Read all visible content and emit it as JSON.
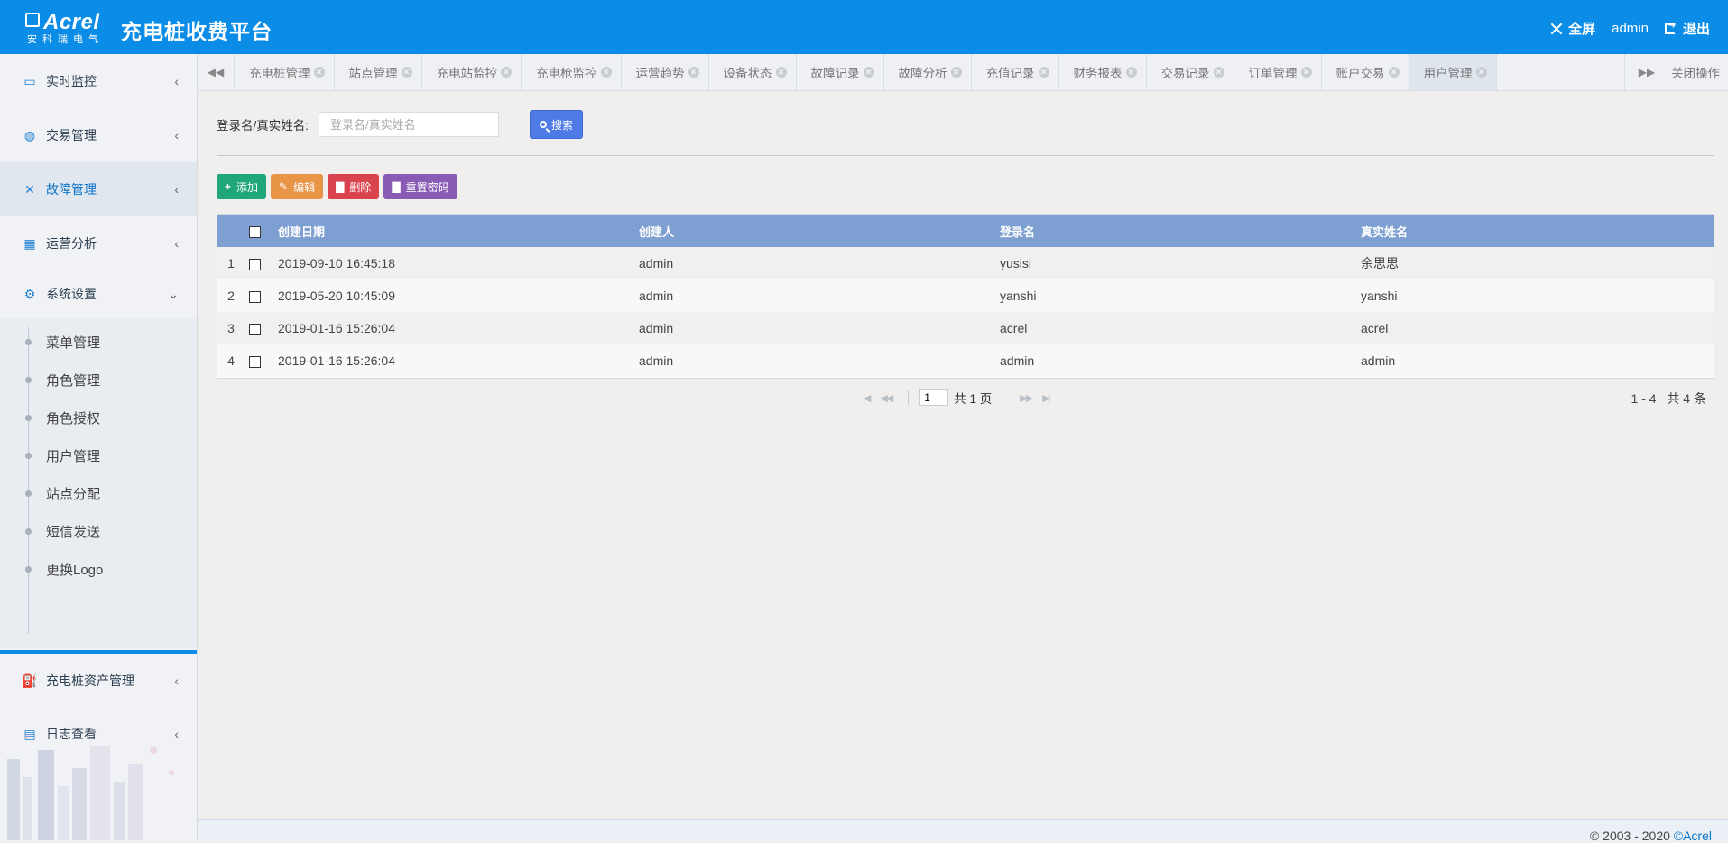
{
  "header": {
    "brand": "Acrel",
    "brand_sub": "安科瑞电气",
    "app_title": "充电桩收费平台",
    "fullscreen_label": "全屏",
    "username": "admin",
    "logout_label": "退出"
  },
  "sidebar": {
    "items": [
      {
        "label": "实时监控",
        "icon": "monitor-icon"
      },
      {
        "label": "交易管理",
        "icon": "trade-icon"
      },
      {
        "label": "故障管理",
        "icon": "tools-icon"
      },
      {
        "label": "运营分析",
        "icon": "calendar-icon"
      },
      {
        "label": "系统设置",
        "icon": "gear-icon"
      },
      {
        "label": "充电桩资产管理",
        "icon": "charger-icon"
      },
      {
        "label": "日志查看",
        "icon": "log-icon"
      }
    ],
    "sub_items": [
      "菜单管理",
      "角色管理",
      "角色授权",
      "用户管理",
      "站点分配",
      "短信发送",
      "更换Logo"
    ]
  },
  "tabs": {
    "items": [
      "充电桩管理",
      "站点管理",
      "充电站监控",
      "充电枪监控",
      "运营趋势",
      "设备状态",
      "故障记录",
      "故障分析",
      "充值记录",
      "财务报表",
      "交易记录",
      "订单管理",
      "账户交易",
      "用户管理"
    ],
    "active_index": 13,
    "close_ops_label": "关闭操作"
  },
  "search": {
    "label": "登录名/真实姓名:",
    "placeholder": "登录名/真实姓名",
    "button_label": "搜索"
  },
  "toolbar": {
    "add_label": "添加",
    "edit_label": "编辑",
    "delete_label": "删除",
    "reset_label": "重置密码"
  },
  "table": {
    "headers": [
      "创建日期",
      "创建人",
      "登录名",
      "真实姓名"
    ],
    "rows": [
      {
        "index": "1",
        "date": "2019-09-10 16:45:18",
        "creator": "admin",
        "login": "yusisi",
        "real_name": "余思思"
      },
      {
        "index": "2",
        "date": "2019-05-20 10:45:09",
        "creator": "admin",
        "login": "yanshi",
        "real_name": "yanshi"
      },
      {
        "index": "3",
        "date": "2019-01-16 15:26:04",
        "creator": "admin",
        "login": "acrel",
        "real_name": "acrel"
      },
      {
        "index": "4",
        "date": "2019-01-16 15:26:04",
        "creator": "admin",
        "login": "admin",
        "real_name": "admin"
      }
    ]
  },
  "pager": {
    "current_page": "1",
    "total_pages_text": "共 1 页",
    "range_text": "1 - 4",
    "total_text": "共 4 条"
  },
  "footer": {
    "copyright": "© 2003 - 2020 ",
    "link": "©Acrel"
  },
  "colors": {
    "header_bg": "#0b8ce6",
    "table_header_bg": "#7d9fd1",
    "add_btn": "#1fa67a",
    "edit_btn": "#e89548",
    "delete_btn": "#d9434e",
    "reset_btn": "#8a5bb5",
    "search_btn": "#4e7ae5"
  }
}
